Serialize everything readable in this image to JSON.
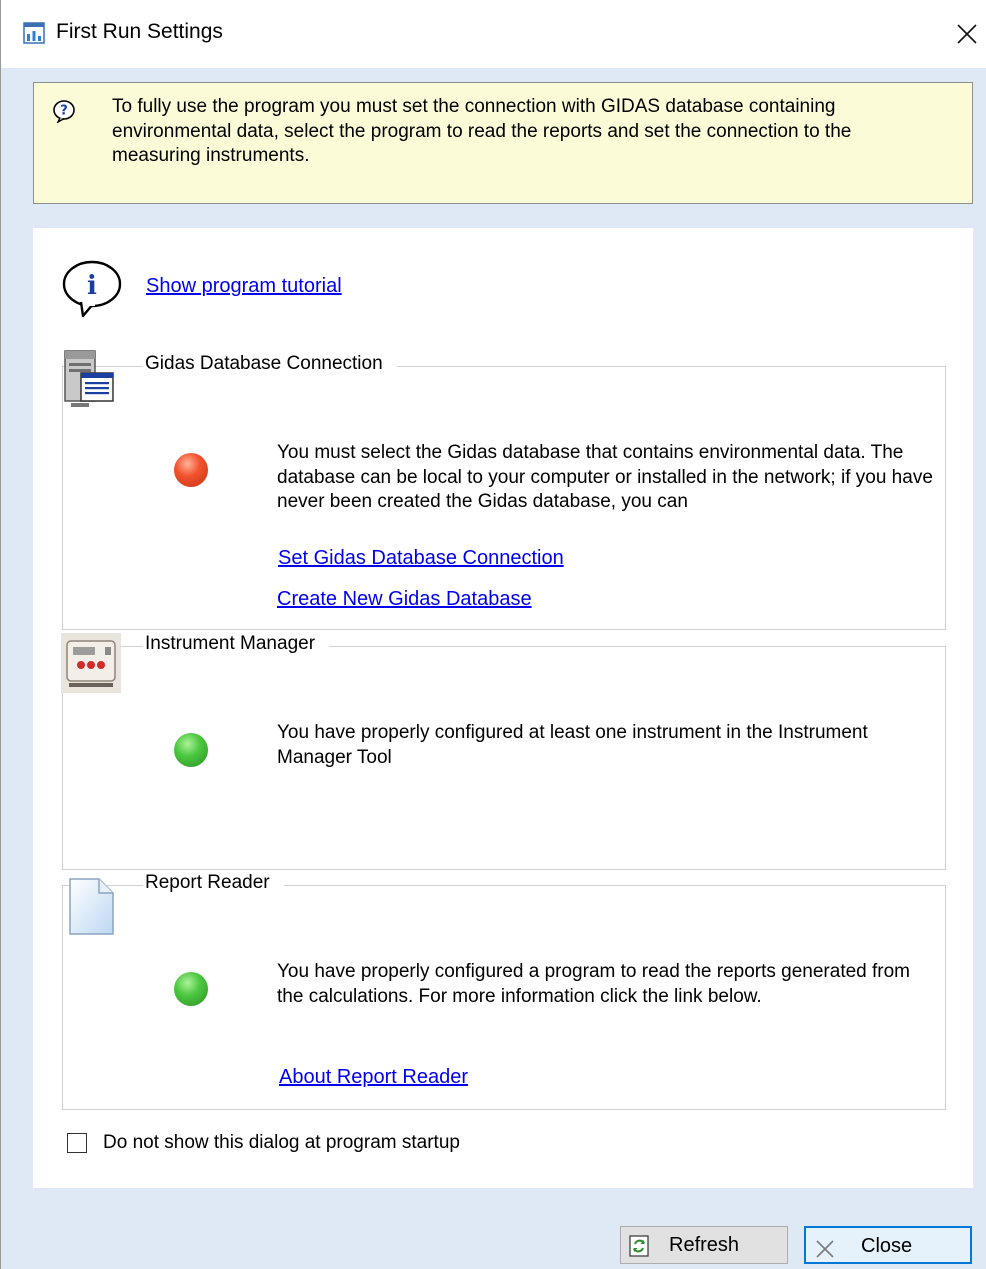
{
  "window": {
    "title": "First Run Settings"
  },
  "banner": {
    "text": "To fully use the program you must set the connection with GIDAS database containing environmental data, select the program to read the reports and set the connection to the measuring instruments."
  },
  "tutorial": {
    "link_label": "Show program tutorial "
  },
  "groups": [
    {
      "title": "Gidas Database Connection",
      "status": "red",
      "message": "You must select the Gidas database that contains environmental data. The database can be local to your computer or installed in the network; if you have never been created the Gidas database, you can",
      "links": [
        "Set Gidas Database Connection",
        "Create New Gidas Database"
      ]
    },
    {
      "title": "Instrument Manager",
      "status": "green",
      "message": "You have properly configured at least one instrument in the Instrument Manager Tool"
    },
    {
      "title": "Report Reader",
      "status": "green",
      "message": "You have properly configured a program to read the reports generated from the calculations. For more information click the link below.",
      "links": [
        "About Report Reader"
      ]
    }
  ],
  "startup_checkbox": {
    "label": "Do not show this dialog at program startup",
    "checked": false
  },
  "buttons": {
    "refresh_label": "Refresh",
    "close_label": "Close"
  },
  "colors": {
    "banner_bg": "#fbfbd8",
    "link": "#0000ee",
    "status_red": "#f2532e",
    "status_green": "#4cc841",
    "window_bg": "#dfe8f5"
  },
  "icons": {
    "app": "chart-app-icon",
    "help": "question-bubble-icon",
    "tutorial": "info-bubble-icon",
    "database": "database-server-icon",
    "instrument": "instrument-device-icon",
    "report": "document-icon",
    "refresh": "refresh-icon",
    "close": "close-x-icon"
  }
}
